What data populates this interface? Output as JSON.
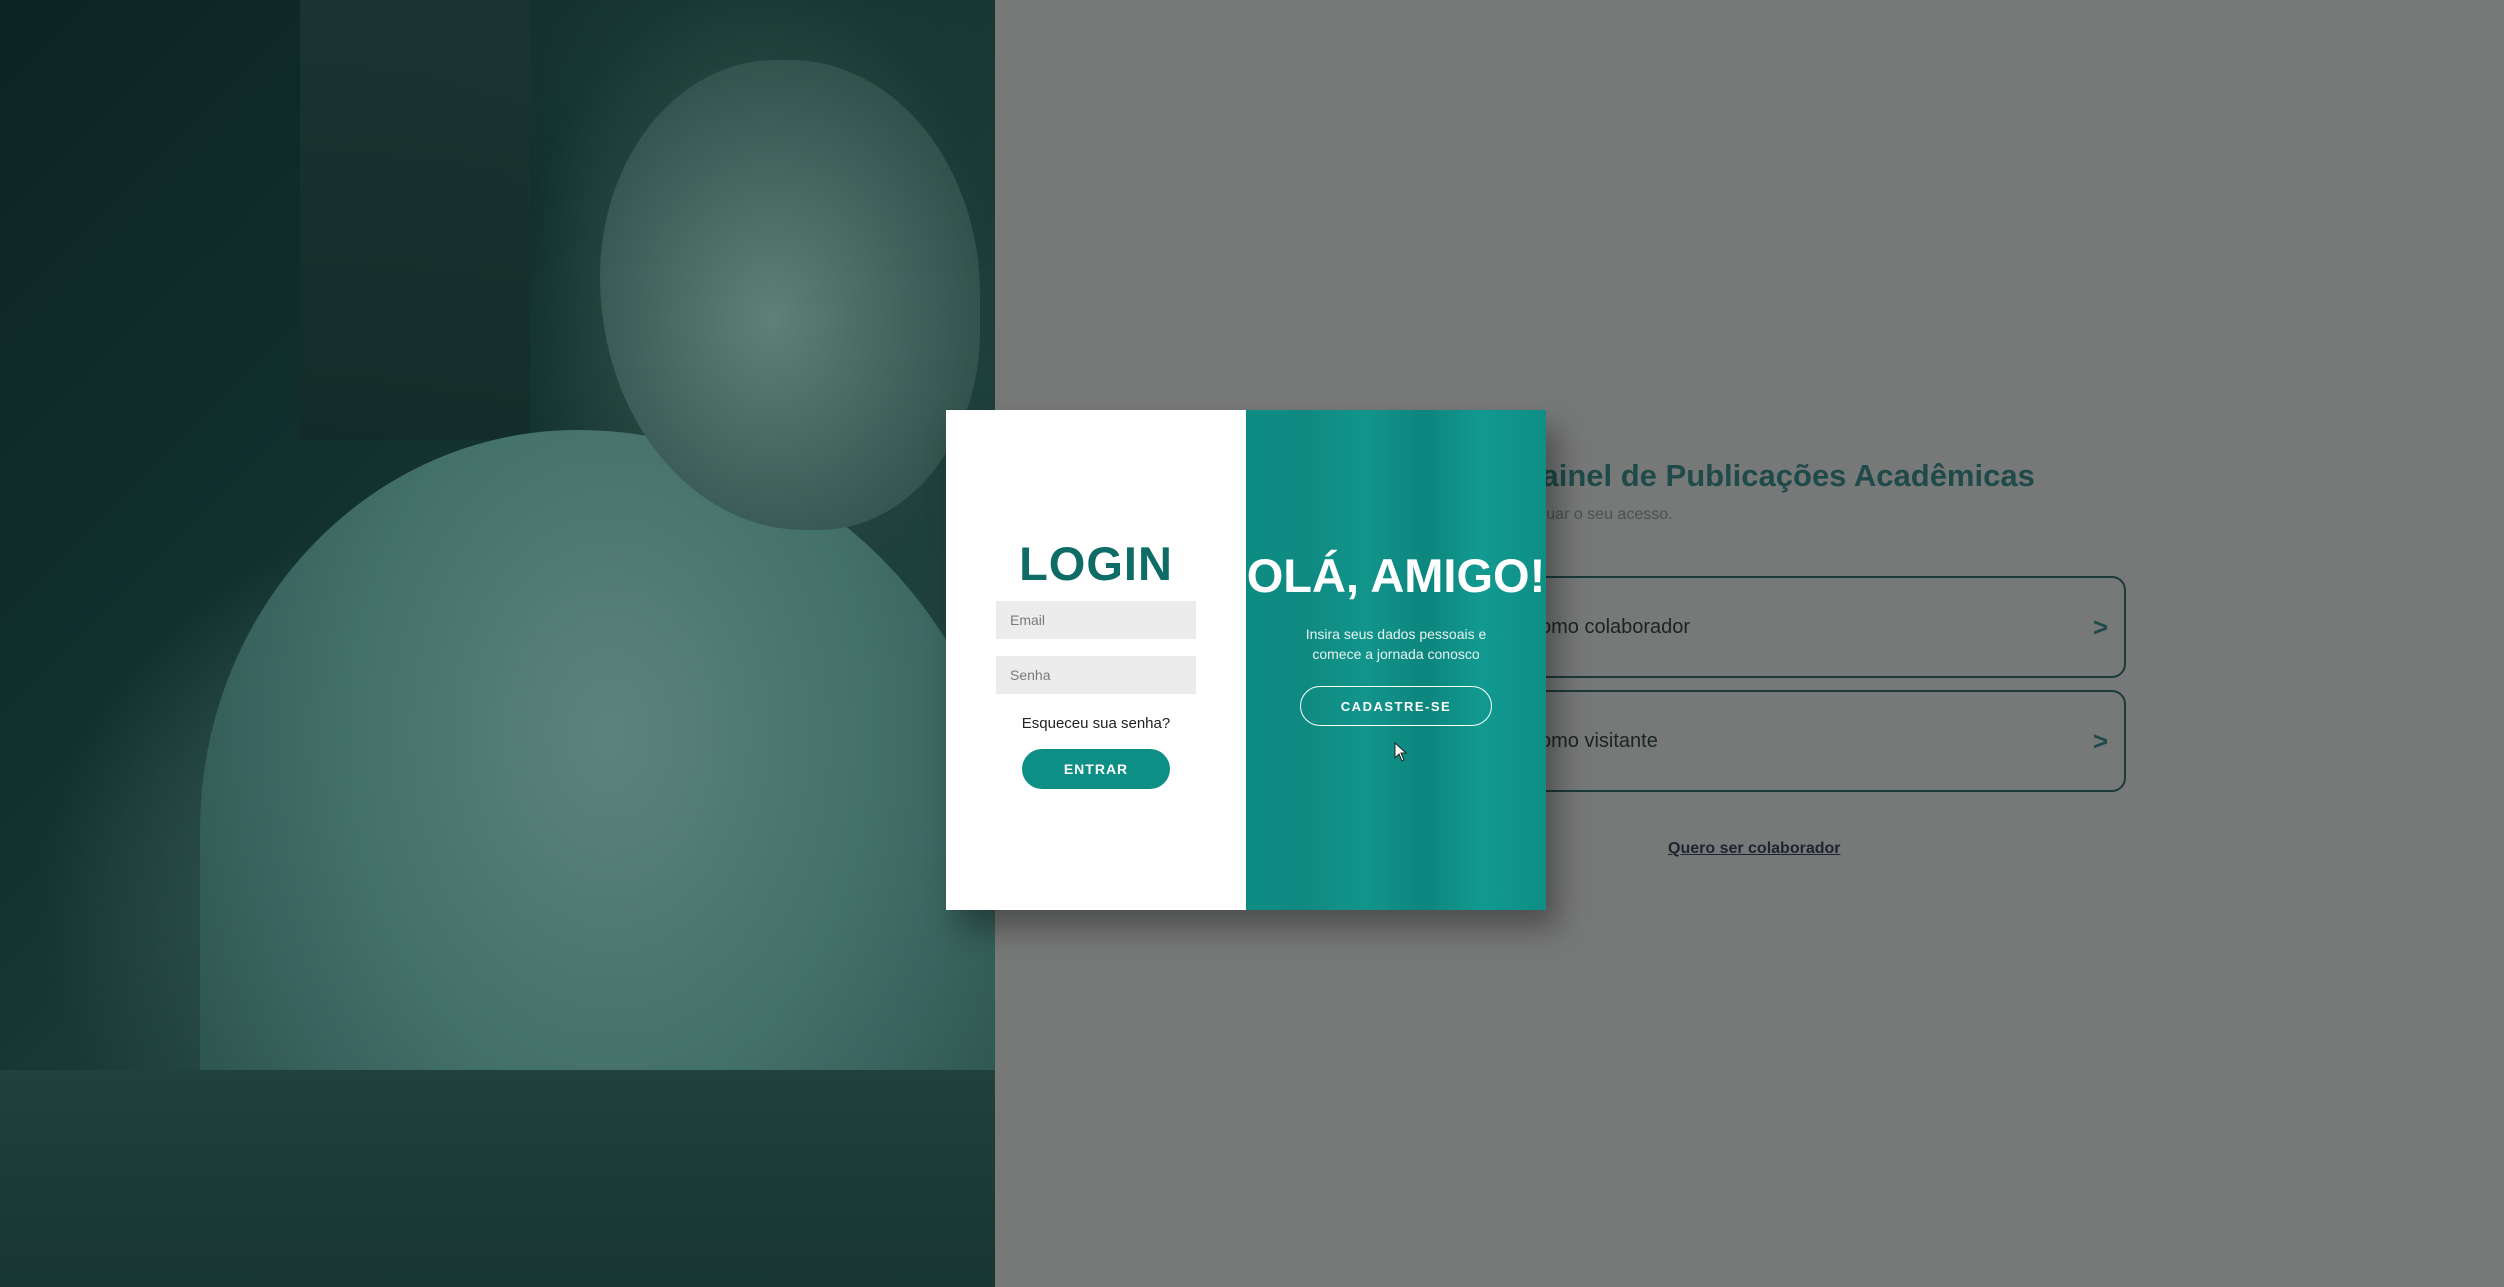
{
  "login": {
    "title": "LOGIN",
    "email_placeholder": "Email",
    "password_placeholder": "Senha",
    "forgot_link": "Esqueceu sua senha?",
    "submit_label": "ENTRAR"
  },
  "welcome_panel": {
    "title": "OLÁ, AMIGO!",
    "text": "Insira seus dados pessoais e comece a jornada conosco",
    "signup_label": "CADASTRE-SE"
  },
  "background_page": {
    "title": "ao Painel de Publicações Acadêmicas",
    "subtitle": "ara continuar o seu acesso.",
    "options": [
      {
        "label": "omo colaborador",
        "chevron": ">"
      },
      {
        "label": "omo visitante",
        "chevron": ">"
      }
    ],
    "become_collaborator_link": "Quero ser colaborador"
  },
  "colors": {
    "accent": "#0d8f85",
    "title_green": "#0f6b66",
    "overlay_gray": "#777878"
  }
}
